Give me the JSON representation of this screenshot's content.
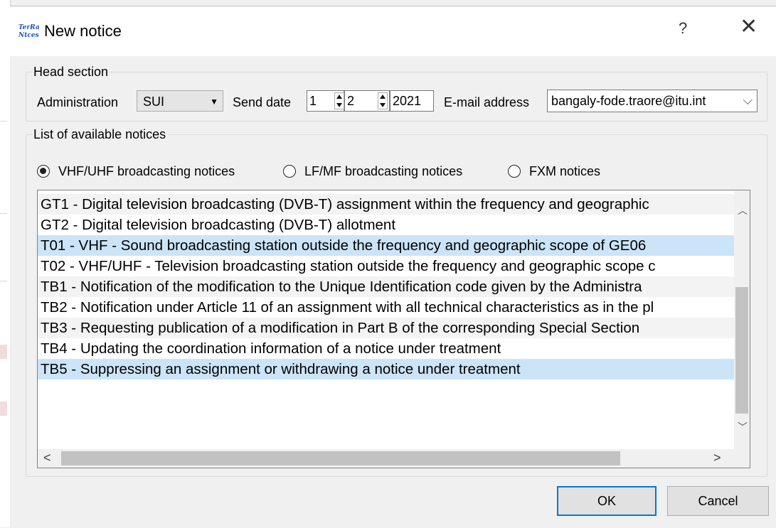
{
  "window": {
    "title": "New notice",
    "app_icon_text": "TerRaNtces",
    "help_label": "?",
    "close_label": "✕"
  },
  "head_section": {
    "legend": "Head section",
    "administration_label": "Administration",
    "administration_value": "SUI",
    "send_date_label": "Send date",
    "send_day": "1",
    "send_month": "2",
    "send_year": "2021",
    "email_label": "E-mail address",
    "email_value": "bangaly-fode.traore@itu.int"
  },
  "notices_section": {
    "legend": "List of available notices",
    "radios": [
      {
        "label": "VHF/UHF broadcasting notices",
        "checked": true
      },
      {
        "label": "LF/MF broadcasting notices",
        "checked": false
      },
      {
        "label": "FXM notices",
        "checked": false
      }
    ],
    "items": [
      {
        "text": "GT1 - Digital television broadcasting (DVB-T) assignment within the frequency and geographic",
        "state": "stripe"
      },
      {
        "text": "GT2 - Digital television broadcasting (DVB-T) allotment",
        "state": "normal"
      },
      {
        "text": "T01 - VHF - Sound broadcasting station outside the frequency and geographic scope of GE06",
        "state": "selected"
      },
      {
        "text": "T02 - VHF/UHF - Television broadcasting station outside the frequency and geographic scope c",
        "state": "normal"
      },
      {
        "text": "TB1 - Notification of the modification to the Unique Identification code given by the Administra",
        "state": "stripe"
      },
      {
        "text": "TB2 - Notification under Article 11 of an assignment with all technical characteristics as in the pl",
        "state": "normal"
      },
      {
        "text": "TB3 - Requesting publication of a modification in Part B of the corresponding Special Section",
        "state": "stripe"
      },
      {
        "text": "TB4 - Updating the coordination information of a notice under treatment",
        "state": "normal"
      },
      {
        "text": "TB5 - Suppressing an assignment or withdrawing a notice under treatment",
        "state": "selected"
      }
    ]
  },
  "buttons": {
    "ok": "OK",
    "cancel": "Cancel"
  },
  "icons": {
    "scroll_up": "chevron-up-icon",
    "scroll_down": "chevron-down-icon",
    "scroll_left": "chevron-left-icon",
    "scroll_right": "chevron-right-icon",
    "dropdown": "triangle-down-icon"
  },
  "colors": {
    "selection": "#cce4f7",
    "default_button_border": "#0078d7",
    "dialog_bg": "#f0f0f0"
  }
}
